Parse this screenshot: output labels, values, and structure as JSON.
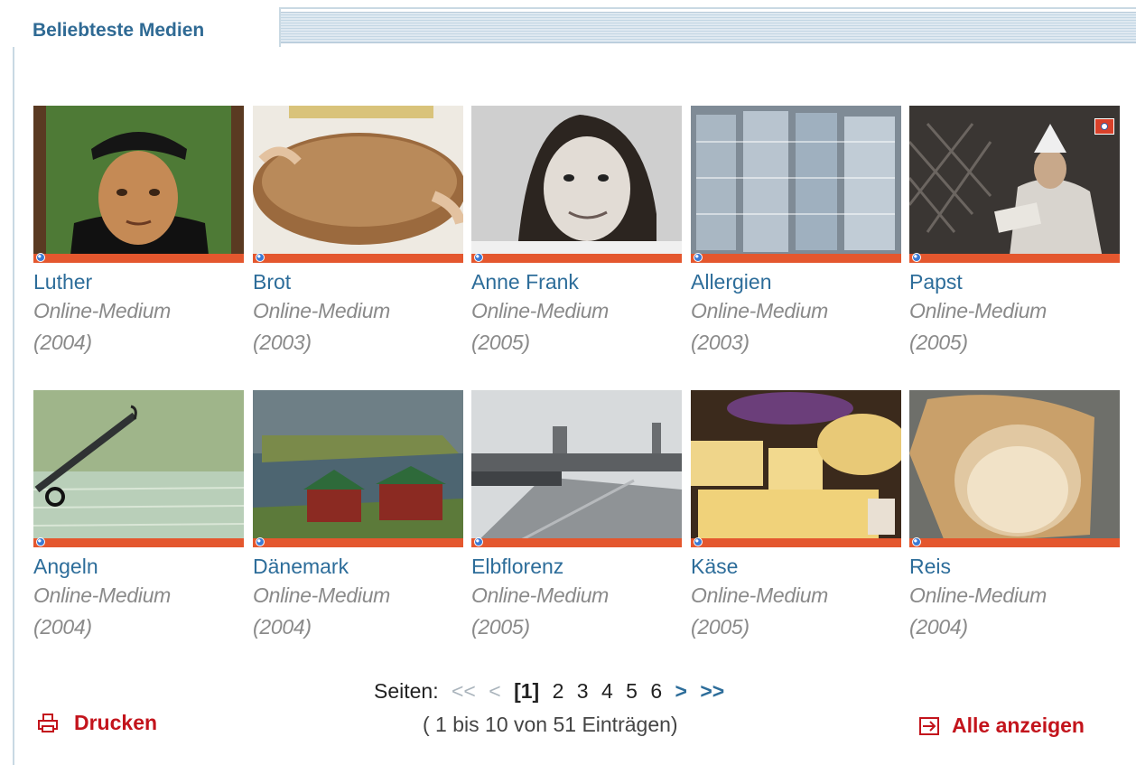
{
  "section": {
    "title": "Beliebteste Medien"
  },
  "items": [
    {
      "title": "Luther",
      "type": "Online-Medium",
      "year": "(2004)",
      "image": "portrait-luther",
      "badge": null
    },
    {
      "title": "Brot",
      "type": "Online-Medium",
      "year": "(2003)",
      "image": "bread-loaf",
      "badge": null
    },
    {
      "title": "Anne Frank",
      "type": "Online-Medium",
      "year": "(2005)",
      "image": "portrait-anne-frank",
      "badge": null
    },
    {
      "title": "Allergien",
      "type": "Online-Medium",
      "year": "(2003)",
      "image": "glass-jars-shelves",
      "badge": null
    },
    {
      "title": "Papst",
      "type": "Online-Medium",
      "year": "(2005)",
      "image": "pope-reading",
      "badge": "flag-icon"
    },
    {
      "title": "Angeln",
      "type": "Online-Medium",
      "year": "(2004)",
      "image": "fishing-rod-water",
      "badge": null
    },
    {
      "title": "Dänemark",
      "type": "Online-Medium",
      "year": "(2004)",
      "image": "coastal-houses",
      "badge": null
    },
    {
      "title": "Elbflorenz",
      "type": "Online-Medium",
      "year": "(2005)",
      "image": "dresden-skyline",
      "badge": null
    },
    {
      "title": "Käse",
      "type": "Online-Medium",
      "year": "(2005)",
      "image": "cheese-wheels",
      "badge": null
    },
    {
      "title": "Reis",
      "type": "Online-Medium",
      "year": "(2004)",
      "image": "rice-sack",
      "badge": null
    }
  ],
  "pagination": {
    "label": "Seiten:",
    "first": "<<",
    "prev": "<",
    "pages": [
      "[1]",
      "2",
      "3",
      "4",
      "5",
      "6"
    ],
    "current_index": 0,
    "next": ">",
    "last": ">>",
    "summary": "( 1 bis 10 von 51 Einträgen)"
  },
  "actions": {
    "print_label": "Drucken",
    "show_all_label": "Alle anzeigen"
  },
  "colors": {
    "accent": "#e4572e",
    "title_blue": "#2f6a94",
    "action_red": "#c3141c"
  }
}
